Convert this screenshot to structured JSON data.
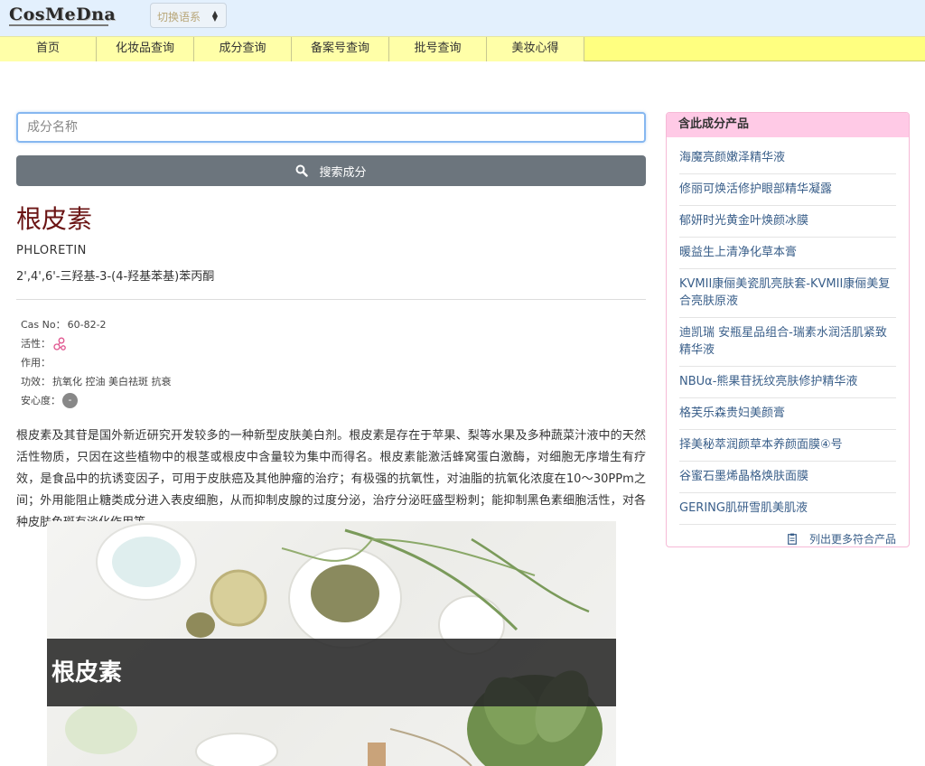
{
  "header": {
    "logo_text": "CosMeDna",
    "lang_select": "切换语系"
  },
  "nav": {
    "items": [
      "首页",
      "化妆品查询",
      "成分查询",
      "备案号查询",
      "批号查询",
      "美妆心得"
    ]
  },
  "search": {
    "placeholder": "成分名称",
    "button_label": "搜索成分"
  },
  "ingredient": {
    "name": "根皮素",
    "english_name": "PHLORETIN",
    "chemical_name": "2',4',6'-三羟基-3-(4-羟基苯基)苯丙酮",
    "cas_label": "Cas No：",
    "cas_value": "60-82-2",
    "activity_label": "活性：",
    "effect_label": "作用：",
    "function_label": "功效：",
    "function_value": "抗氧化 控油 美白祛斑 抗衰",
    "safety_label": "安心度：",
    "safety_value": "-",
    "description": "根皮素及其苷是国外新近研究开发较多的一种新型皮肤美白剂。根皮素是存在于苹果、梨等水果及多种蔬菜汁液中的天然活性物质，只因在这些植物中的根茎或根皮中含量较为集中而得名。根皮素能激活蜂窝蛋白激酶，对细胞无序增生有疗效，是食品中的抗诱变因子，可用于皮肤癌及其他肿瘤的治疗；有极强的抗氧性，对油脂的抗氧化浓度在10～30PPm之间；外用能阻止糖类成分进入表皮细胞，从而抑制皮腺的过度分泌，治疗分泌旺盛型粉刺；能抑制黑色素细胞活性，对各种皮肤色斑有淡化作用等。",
    "hero_title": "根皮素"
  },
  "sidebar": {
    "title": "含此成分产品",
    "products": [
      "海魔亮颜嫩泽精华液",
      "修丽可焕活修护眼部精华凝露",
      "郁妍时光黄金叶焕颜冰膜",
      "暖益生上清净化草本膏",
      "KVMII康俪美瓷肌亮肤套-KVMII康俪美复合亮肤原液",
      "迪凯瑞 安瓶星品组合-瑞素水润活肌紧致精华液",
      "NBUα-熊果苷抚纹亮肤修护精华液",
      "格芙乐森贵妇美颜膏",
      "择美秘萃润颜草本养颜面膜④号",
      "谷蜜石墨烯晶格焕肤面膜",
      "GERING肌研雪肌美肌液"
    ],
    "more_label": "列出更多符合产品"
  },
  "colors": {
    "nav_bg": "#ffff88",
    "topbar_bg": "#e3f0fd",
    "title_color": "#6b1414",
    "sidebar_head_bg": "#ffcae6",
    "link_color": "#3a5f8a",
    "search_button_bg": "#6c757d"
  }
}
